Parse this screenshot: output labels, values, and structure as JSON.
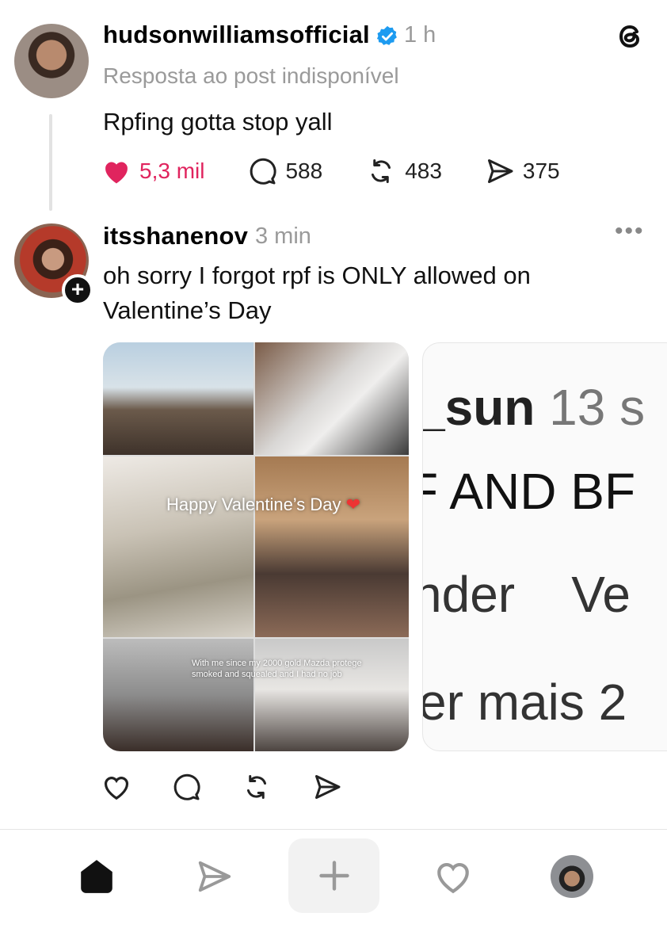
{
  "post1": {
    "username": "hudsonwilliamsofficial",
    "verified": true,
    "time": "1 h",
    "reply_note": "Resposta ao post indisponível",
    "text": "Rpfing gotta stop yall",
    "likes": "5,3 mil",
    "comments": "588",
    "reposts": "483",
    "shares": "375",
    "liked": true
  },
  "post2": {
    "username": "itsshanenov",
    "time": "3 min",
    "text": "oh sorry I forgot rpf is ONLY allowed on Valentine’s Day",
    "collage_overlay": "Happy Valentine’s Day",
    "collage_caption": "With me since my 2000 gold Mazda protege smoked and squealed and I had no job",
    "peek": {
      "line1_bold": "_sun",
      "line1_rest": " 13 s",
      "line2": "F AND BF",
      "line3": "nder    Ve",
      "line4": "er mais 2"
    }
  },
  "icons": {
    "threads_logo": "threads-logo-icon",
    "more": "more-dots-icon",
    "heart": "heart-icon",
    "comment": "comment-icon",
    "repost": "repost-icon",
    "share": "send-icon",
    "home": "home-icon",
    "plus": "plus-icon"
  },
  "colors": {
    "like_red": "#e0245e",
    "verified_blue": "#1d9bf0",
    "muted": "#9a9a9a"
  }
}
